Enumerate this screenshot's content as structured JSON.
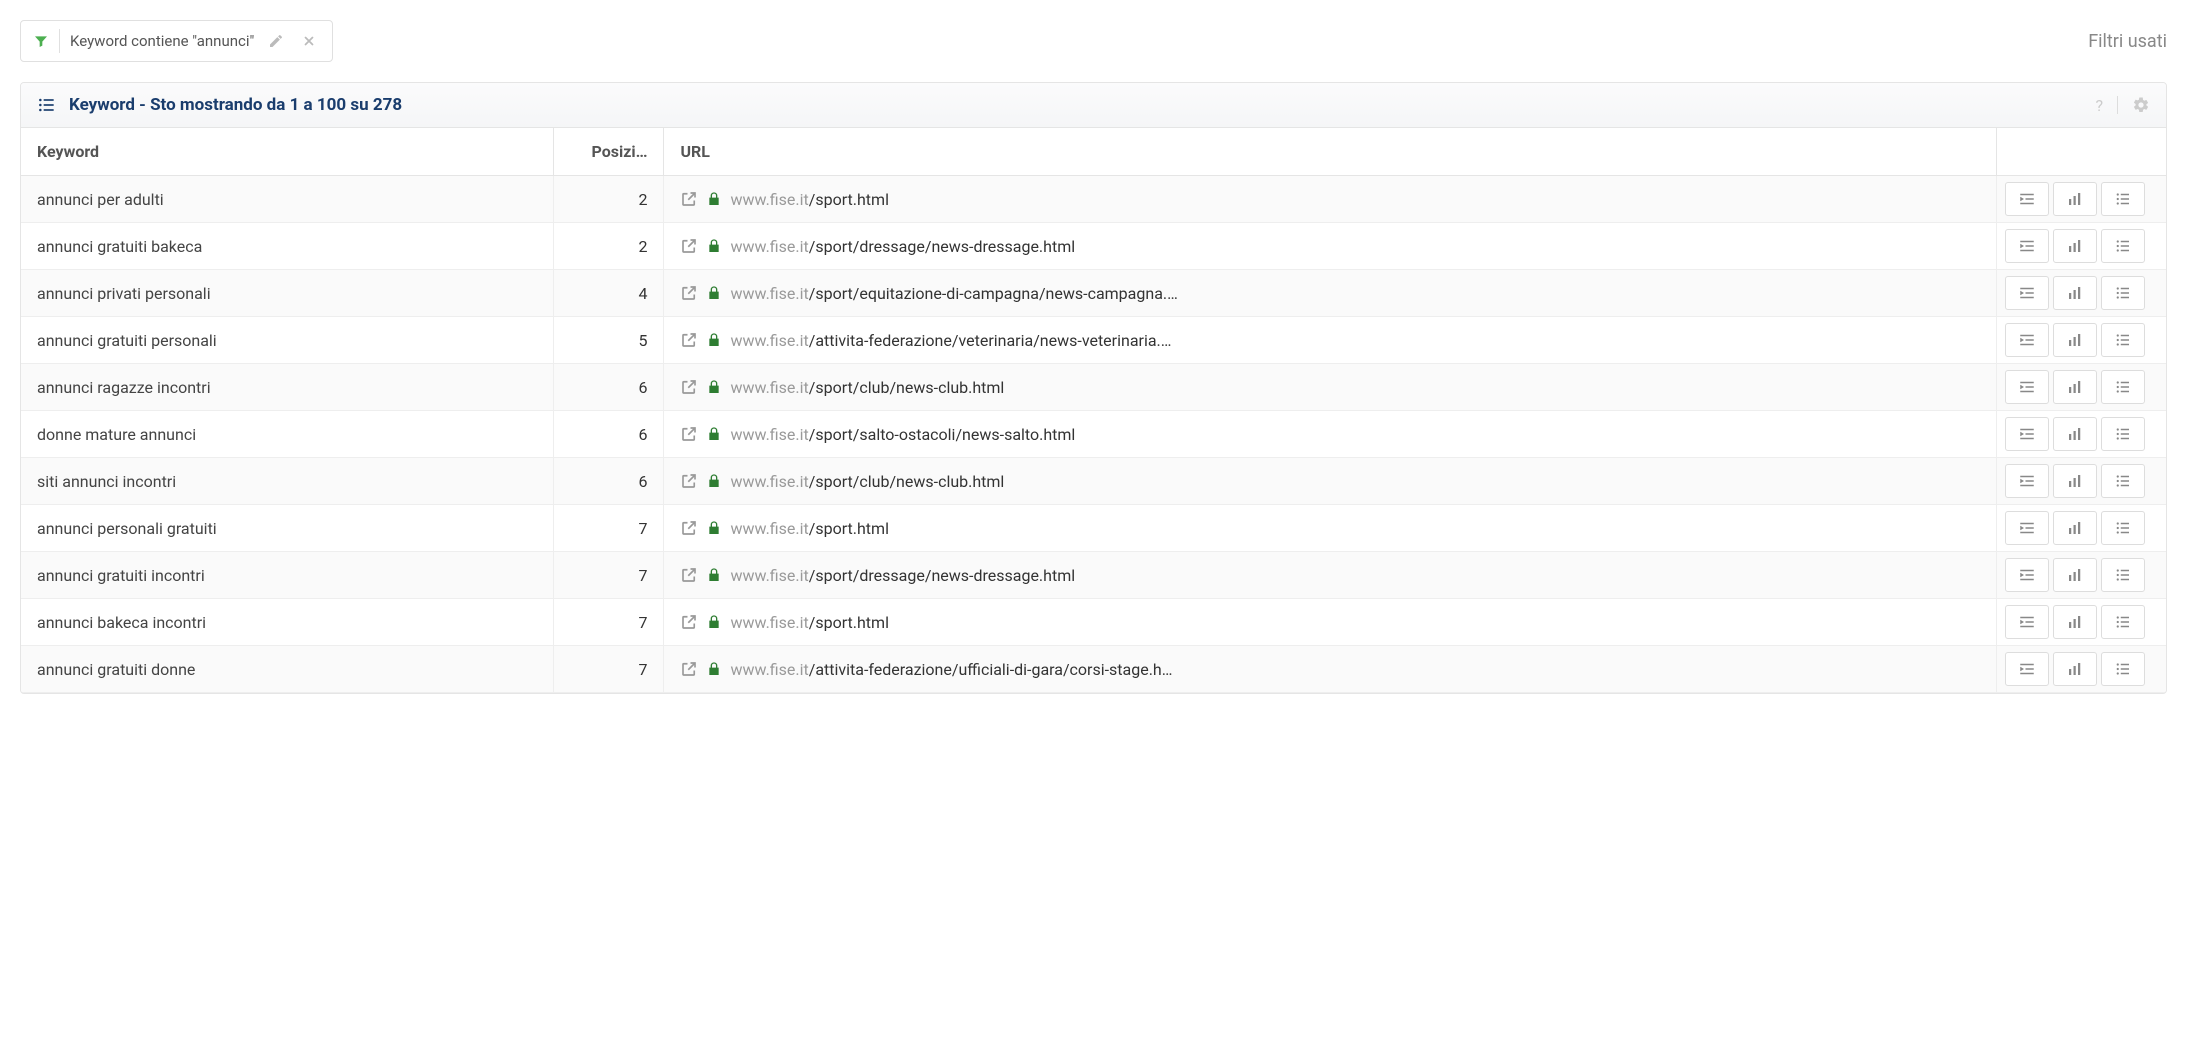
{
  "filter": {
    "text": "Keyword contiene \"annunci\""
  },
  "filters_used_label": "Filtri usati",
  "panel_title": "Keyword - Sto mostrando da 1 a 100 su 278",
  "columns": {
    "keyword": "Keyword",
    "position": "Posizi…",
    "url": "URL"
  },
  "url_domain": "www.fise.it",
  "rows": [
    {
      "keyword": "annunci per adulti",
      "position": "2",
      "url_path": "/sport.html"
    },
    {
      "keyword": "annunci gratuiti bakeca",
      "position": "2",
      "url_path": "/sport/dressage/news-dressage.html"
    },
    {
      "keyword": "annunci privati personali",
      "position": "4",
      "url_path": "/sport/equitazione-di-campagna/news-campagna.…"
    },
    {
      "keyword": "annunci gratuiti personali",
      "position": "5",
      "url_path": "/attivita-federazione/veterinaria/news-veterinaria.…"
    },
    {
      "keyword": "annunci ragazze incontri",
      "position": "6",
      "url_path": "/sport/club/news-club.html"
    },
    {
      "keyword": "donne mature annunci",
      "position": "6",
      "url_path": "/sport/salto-ostacoli/news-salto.html"
    },
    {
      "keyword": "siti annunci incontri",
      "position": "6",
      "url_path": "/sport/club/news-club.html"
    },
    {
      "keyword": "annunci personali gratuiti",
      "position": "7",
      "url_path": "/sport.html"
    },
    {
      "keyword": "annunci gratuiti incontri",
      "position": "7",
      "url_path": "/sport/dressage/news-dressage.html"
    },
    {
      "keyword": "annunci bakeca incontri",
      "position": "7",
      "url_path": "/sport.html"
    },
    {
      "keyword": "annunci gratuiti donne",
      "position": "7",
      "url_path": "/attivita-federazione/ufficiali-di-gara/corsi-stage.h…"
    }
  ]
}
